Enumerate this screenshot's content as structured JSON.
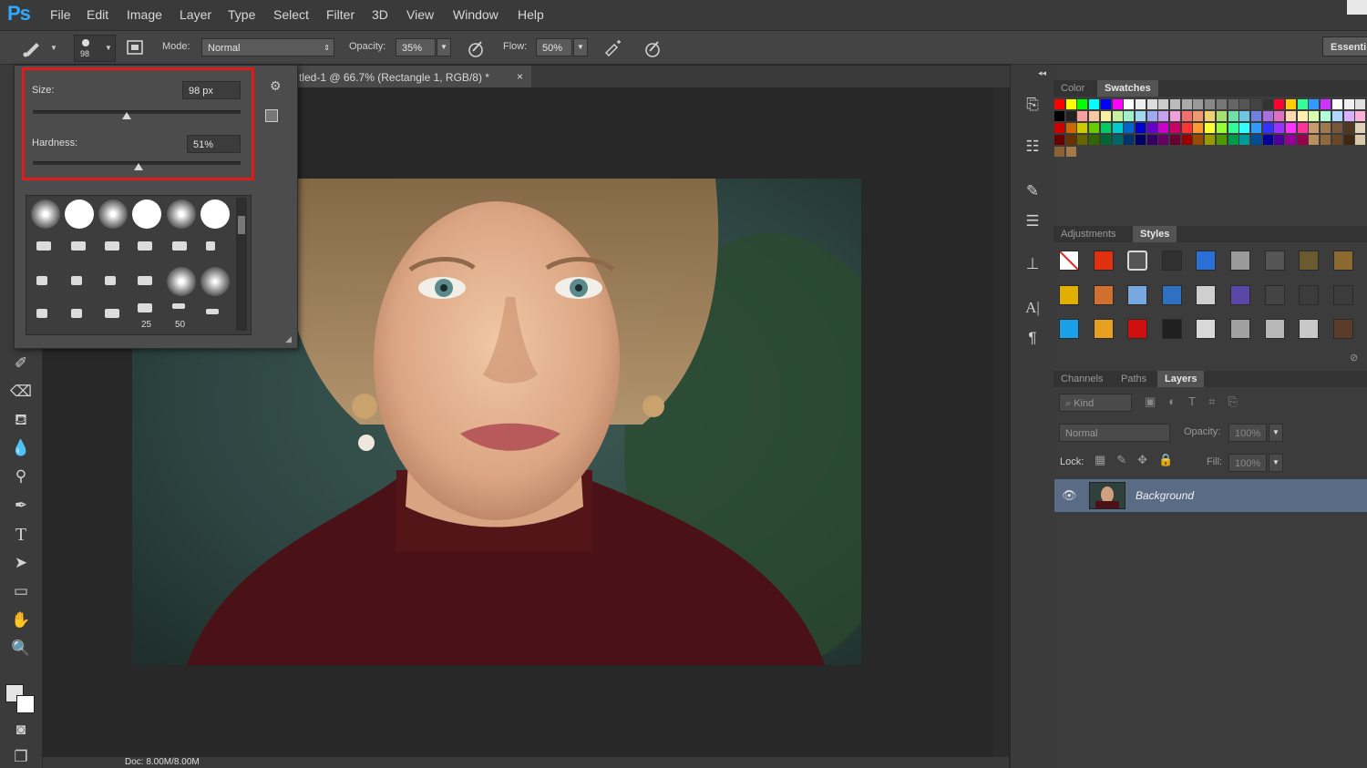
{
  "app": {
    "logo": "Ps"
  },
  "menu": [
    "File",
    "Edit",
    "Image",
    "Layer",
    "Type",
    "Select",
    "Filter",
    "3D",
    "View",
    "Window",
    "Help"
  ],
  "options_bar": {
    "brush_size_badge": "98",
    "mode_label": "Mode:",
    "mode_value": "Normal",
    "opacity_label": "Opacity:",
    "opacity_value": "35%",
    "flow_label": "Flow:",
    "flow_value": "50%",
    "workspace": "Essenti"
  },
  "document_tab": {
    "title": "tled-1 @ 66.7% (Rectangle 1, RGB/8) *",
    "close": "×"
  },
  "brush_popup": {
    "size_label": "Size:",
    "size_value": "98 px",
    "size_level": 0.45,
    "hardness_label": "Hardness:",
    "hardness_value": "51%",
    "hardness_level": 0.51,
    "preset_labels": [
      "25",
      "50"
    ]
  },
  "status_bar": {
    "doc": "Doc: 8.00M/8.00M"
  },
  "panels": {
    "color_tabs": [
      "Color",
      "Swatches"
    ],
    "adjust_tabs": [
      "Adjustments",
      "Styles"
    ],
    "layer_tabs": [
      "Channels",
      "Paths",
      "Layers"
    ],
    "layers": {
      "filter_kind": "Kind",
      "blend_mode": "Normal",
      "opacity_label": "Opacity:",
      "opacity_value": "100%",
      "lock_label": "Lock:",
      "fill_label": "Fill:",
      "fill_value": "100%",
      "items": [
        {
          "name": "Background"
        }
      ]
    }
  },
  "colors": {
    "accent_red": "#e11b1b",
    "ps_blue": "#31a8ff",
    "selected_layer": "#5a6b85"
  },
  "icons": [
    "brush-icon",
    "brush-preset-icon",
    "airbrush-icon",
    "pressure-icon",
    "gear-icon",
    "new-preset-icon",
    "eye-icon",
    "lock-icon",
    "move-icon",
    "type-icon",
    "zoom-icon",
    "hand-icon"
  ]
}
